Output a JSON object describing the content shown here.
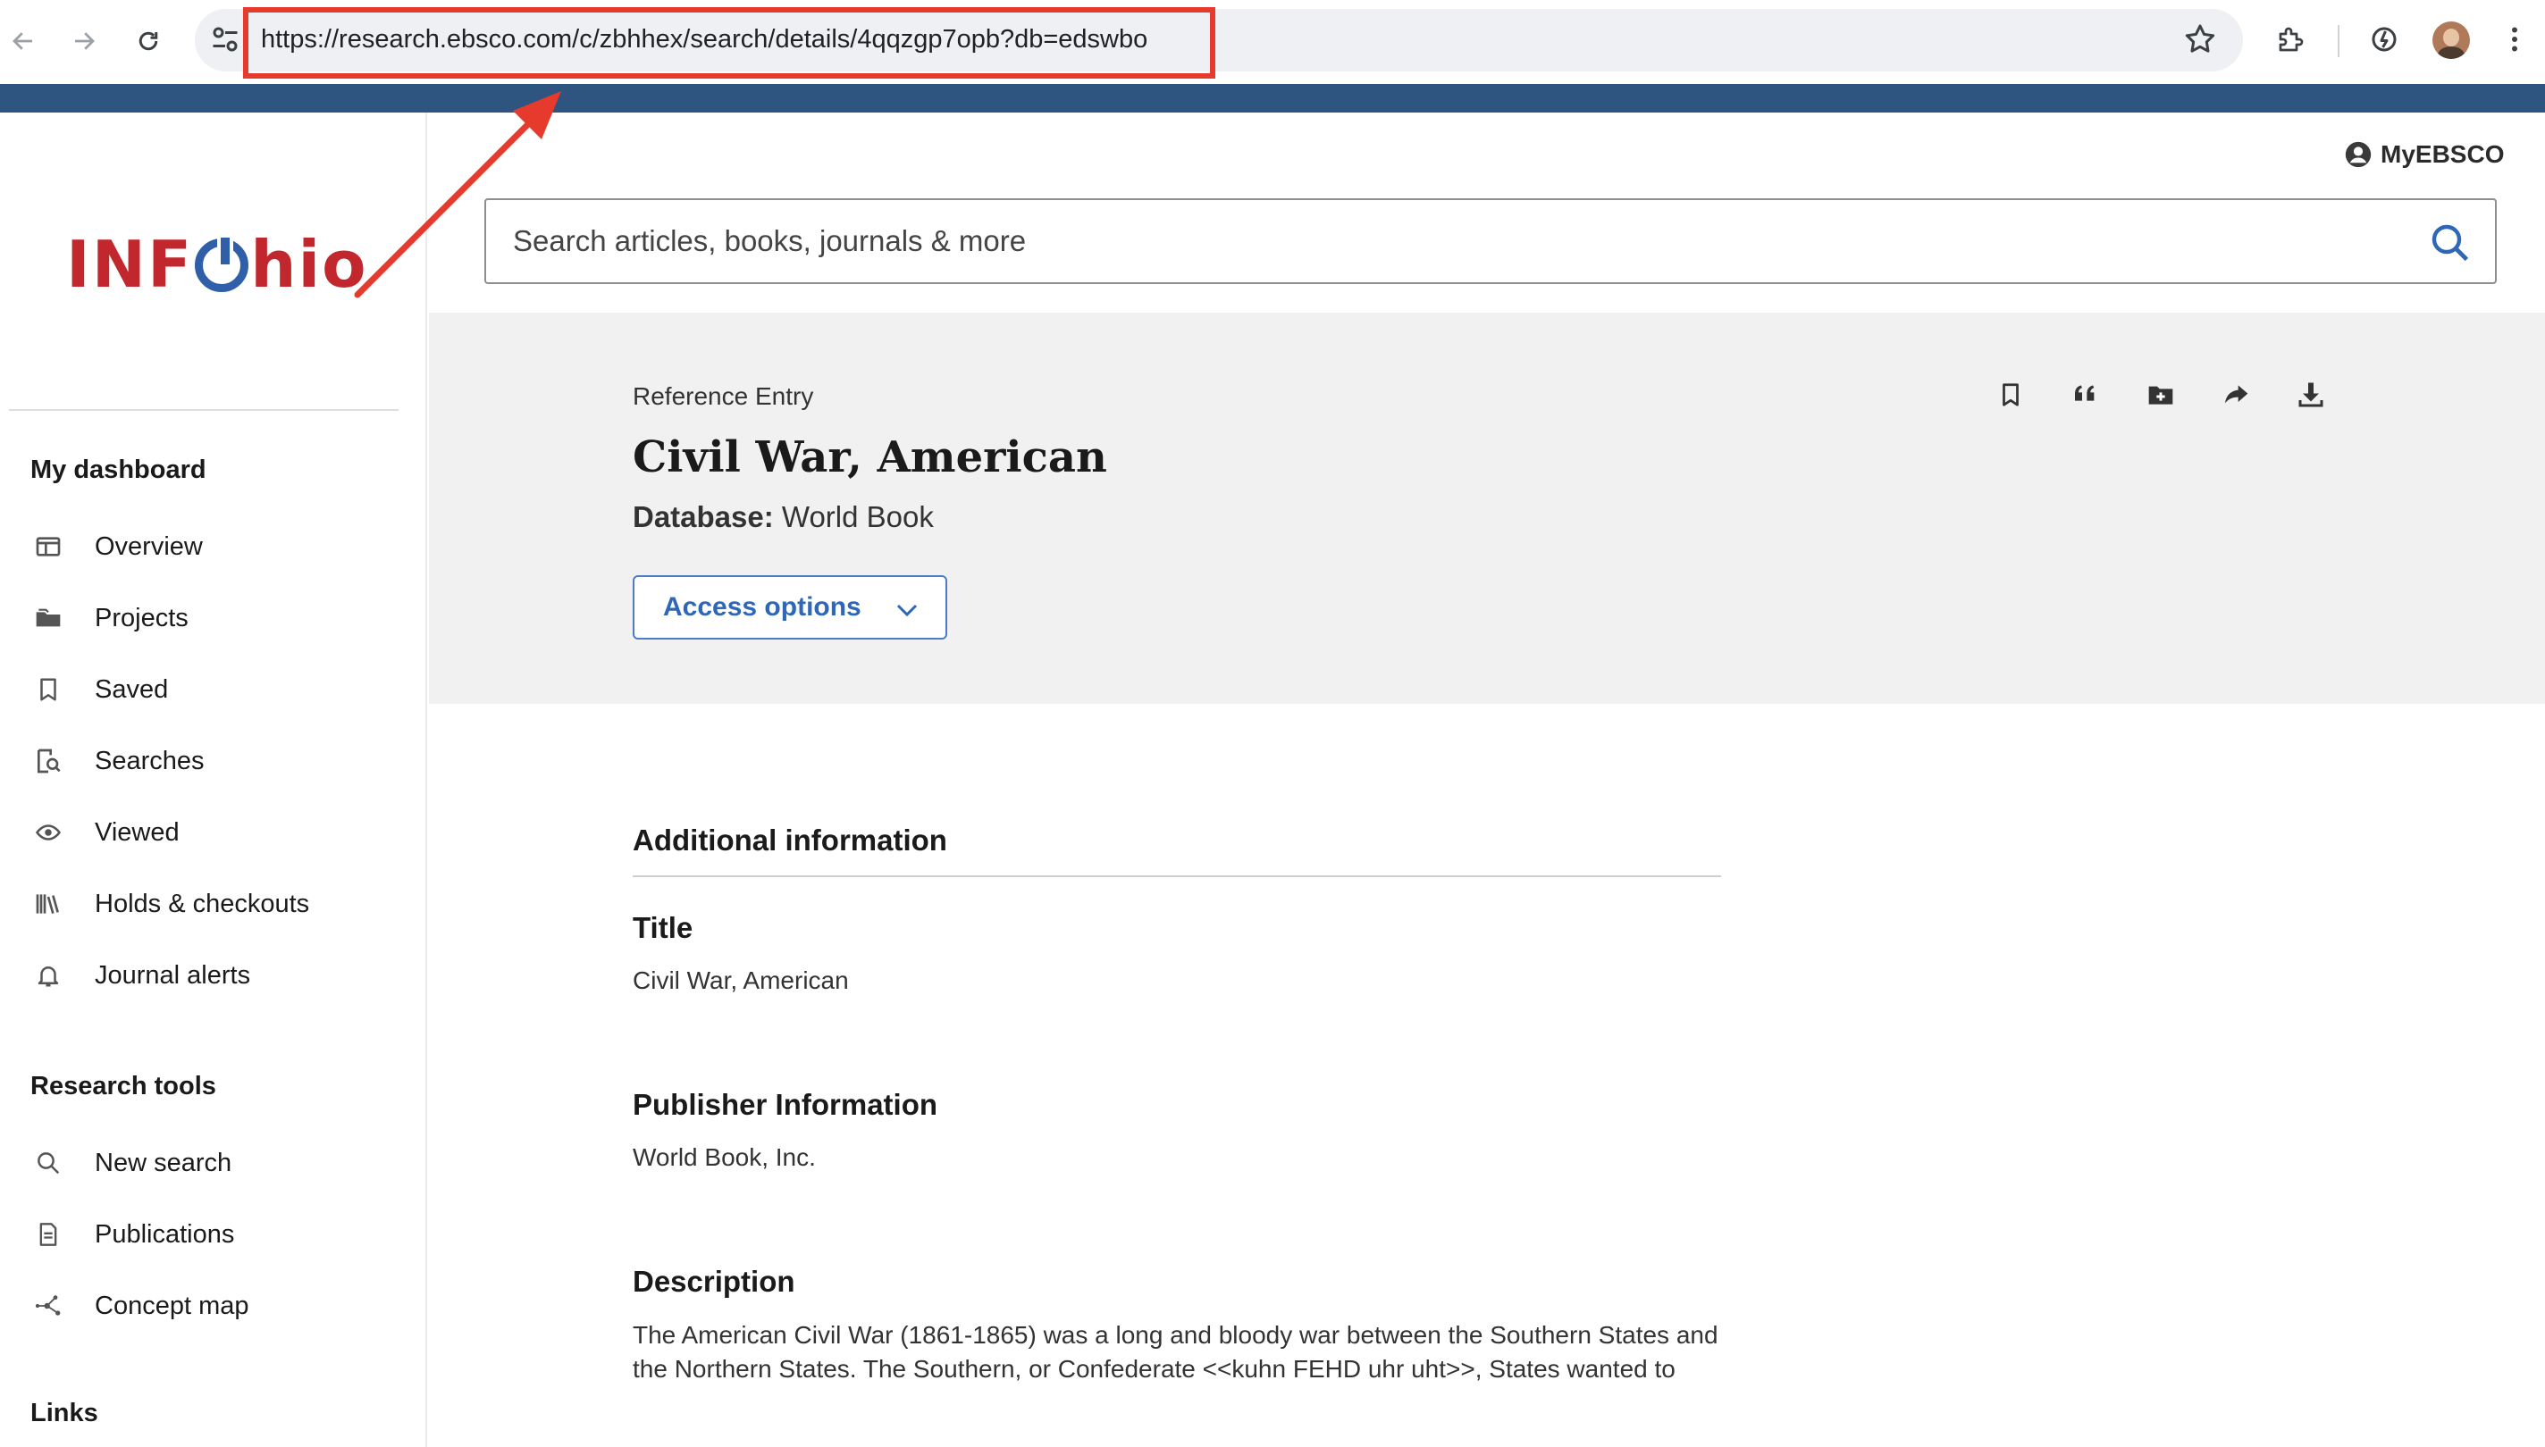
{
  "browser": {
    "url": "https://research.ebsco.com/c/zbhhex/search/details/4qqzgp7opb?db=edswbo"
  },
  "header": {
    "account_label": "MyEBSCO",
    "search_placeholder": "Search articles, books, journals & more"
  },
  "sidebar": {
    "logo_text_left": "INF",
    "logo_text_right": "hio",
    "dashboard_heading": "My dashboard",
    "dashboard_items": [
      {
        "label": "Overview",
        "icon": "overview-icon"
      },
      {
        "label": "Projects",
        "icon": "folder-icon"
      },
      {
        "label": "Saved",
        "icon": "bookmark-icon"
      },
      {
        "label": "Searches",
        "icon": "search-history-icon"
      },
      {
        "label": "Viewed",
        "icon": "eye-icon"
      },
      {
        "label": "Holds & checkouts",
        "icon": "books-icon"
      },
      {
        "label": "Journal alerts",
        "icon": "bell-icon"
      }
    ],
    "research_heading": "Research tools",
    "research_items": [
      {
        "label": "New search",
        "icon": "search-icon"
      },
      {
        "label": "Publications",
        "icon": "document-icon"
      },
      {
        "label": "Concept map",
        "icon": "concept-map-icon"
      }
    ],
    "links_heading": "Links"
  },
  "record": {
    "type": "Reference Entry",
    "title": "Civil War, American",
    "database_label": "Database:",
    "database_value": "World Book",
    "access_button": "Access options"
  },
  "details": {
    "heading": "Additional information",
    "title_label": "Title",
    "title_value": "Civil War, American",
    "publisher_label": "Publisher Information",
    "publisher_value": "World Book, Inc.",
    "description_label": "Description",
    "description_value": "The American Civil War (1861-1865) was a long and bloody war between the Southern States and the Northern States. The Southern, or Confederate <<kuhn FEHD uhr uht>>, States wanted to"
  },
  "colors": {
    "brand_bar": "#2e5480",
    "annotation_red": "#e53a2c",
    "link_blue": "#2e67b8"
  }
}
